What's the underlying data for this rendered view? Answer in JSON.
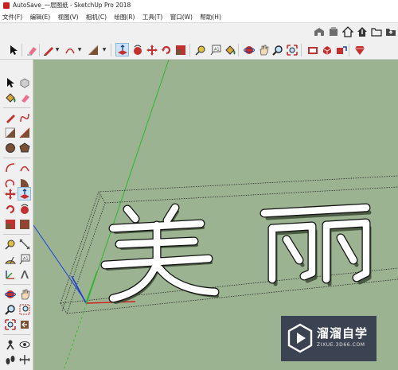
{
  "window": {
    "title": "AutoSave_一层图纸 - SketchUp Pro 2018"
  },
  "menu": [
    "文件(F)",
    "编辑(E)",
    "视图(V)",
    "相机(C)",
    "绘图(R)",
    "工具(T)",
    "窗口(W)",
    "帮助(H)"
  ],
  "colors": {
    "viewport_bg": "#9bb391",
    "axis_red": "#d21e1e",
    "axis_green": "#2fb52f",
    "axis_blue": "#1d3fd6",
    "watermark_bg": "#2d3248",
    "text_3d_face": "#ffffff"
  },
  "model_text": "美丽",
  "watermark": {
    "title": "溜溜自学",
    "url": "ZIXUE.3D66.COM"
  },
  "toolbar_top": [
    "warehouse-icon",
    "extension-icon",
    "home-icon",
    "upload-icon",
    "folder-icon",
    "share-icon"
  ],
  "toolbar_main": [
    "select-icon",
    "eraser-icon",
    "pencil-icon",
    "arc-icon",
    "rectangle-icon",
    "push-pull-icon",
    "follow-me-icon",
    "move-icon",
    "rotate-icon",
    "scale-icon",
    "tape-measure-icon",
    "text-icon",
    "paint-bucket-icon",
    "orbit-icon",
    "pan-icon",
    "zoom-icon",
    "zoom-extents-icon",
    "geo-location-icon",
    "shadow-icon",
    "components-icon",
    "ruby-icon"
  ],
  "toolbar_left": [
    "select-icon",
    "component-icon",
    "paint-bucket-icon",
    "eraser-icon",
    "line-icon",
    "freehand-icon",
    "rectangle-icon",
    "rotated-rectangle-icon",
    "circle-icon",
    "polygon-icon",
    "arc-icon",
    "two-point-arc-icon",
    "three-point-arc-icon",
    "pie-icon",
    "move-icon",
    "push-pull-icon",
    "rotate-icon",
    "follow-me-icon",
    "scale-icon",
    "offset-icon",
    "tape-measure-icon",
    "dimension-icon",
    "protractor-icon",
    "text-icon",
    "axes-icon",
    "3d-text-icon",
    "orbit-icon",
    "pan-icon",
    "zoom-icon",
    "zoom-window-icon",
    "zoom-extents-icon",
    "previous-view-icon",
    "position-camera-icon",
    "look-around-icon",
    "walk-icon",
    "section-plane-icon"
  ]
}
